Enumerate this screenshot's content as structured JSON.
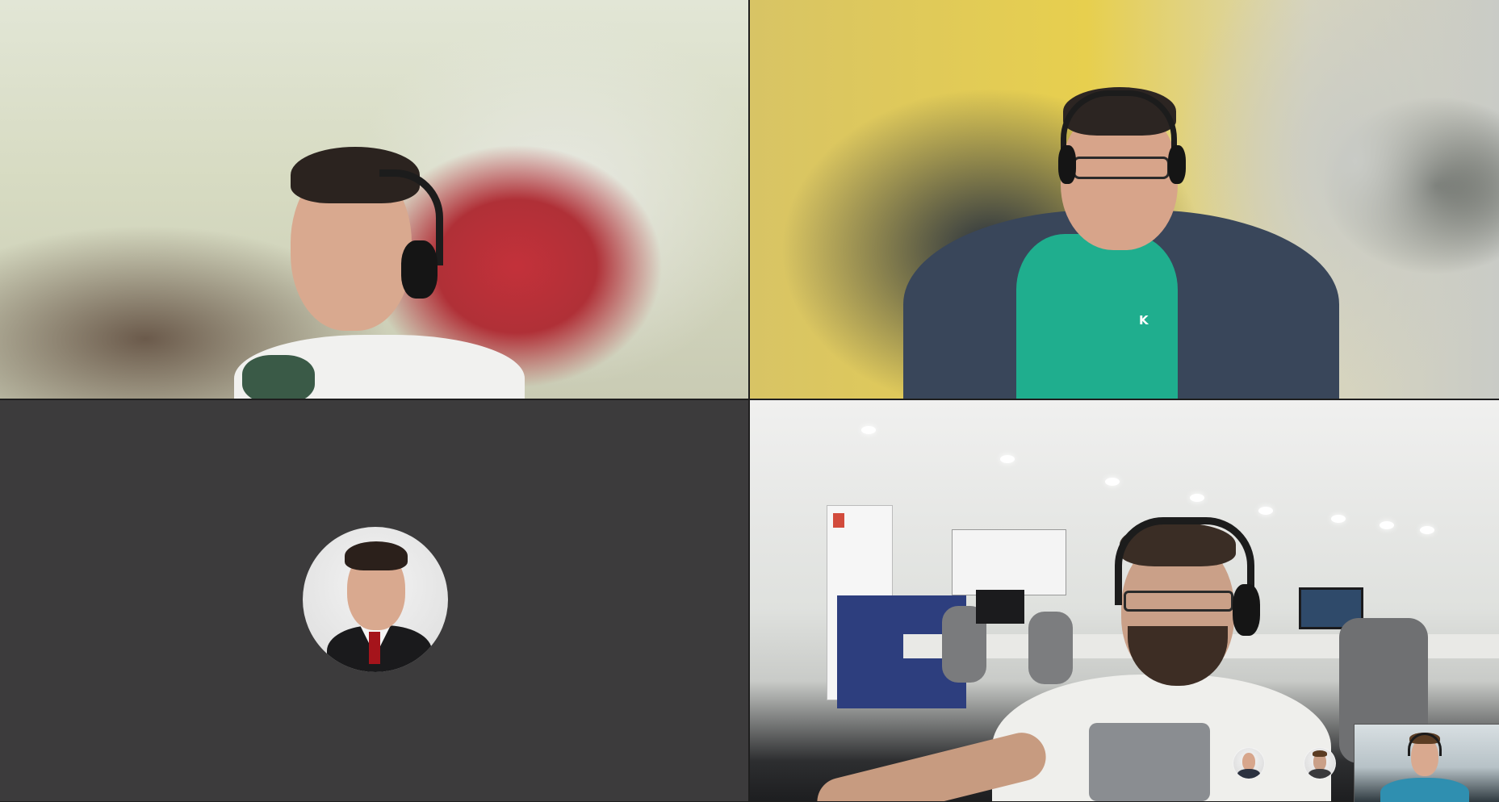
{
  "call": {
    "tiles": [
      {
        "id": "participant-1",
        "type": "video",
        "video_on": true,
        "headset": true
      },
      {
        "id": "participant-2",
        "type": "video",
        "video_on": true,
        "headset": true,
        "shirt_logo_text": "K"
      },
      {
        "id": "participant-3",
        "type": "avatar",
        "video_on": false
      },
      {
        "id": "participant-4",
        "type": "video",
        "video_on": true,
        "headset": true
      }
    ],
    "self_view": {
      "video_on": true
    },
    "participant_chips": [
      {
        "id": "chip-1"
      },
      {
        "id": "chip-2"
      }
    ]
  },
  "colors": {
    "grid_gap": "#1e1e1e",
    "avatar_tile_bg": "#3c3b3c",
    "teal_shirt": "#1fae8e",
    "hoodie": "#39465a"
  }
}
